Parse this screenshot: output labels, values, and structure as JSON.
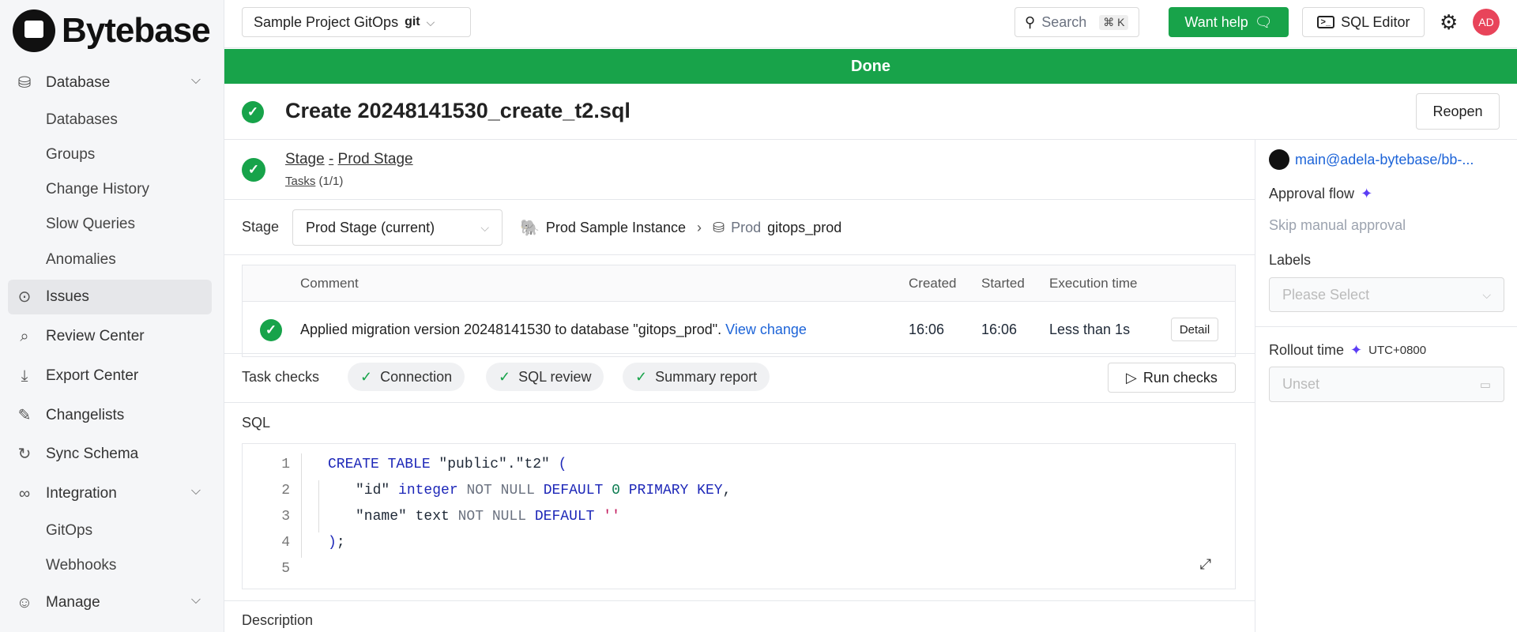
{
  "brand": {
    "name": "Bytebase"
  },
  "sidebar": {
    "items": [
      {
        "label": "Database",
        "icon": "database-icon",
        "expandable": true
      },
      {
        "label": "Databases",
        "sub": true
      },
      {
        "label": "Groups",
        "sub": true
      },
      {
        "label": "Change History",
        "sub": true
      },
      {
        "label": "Slow Queries",
        "sub": true
      },
      {
        "label": "Anomalies",
        "sub": true
      },
      {
        "label": "Issues",
        "icon": "circle-dot-icon",
        "active": true
      },
      {
        "label": "Review Center",
        "icon": "review-icon"
      },
      {
        "label": "Export Center",
        "icon": "download-icon"
      },
      {
        "label": "Changelists",
        "icon": "pencil-ruler-icon"
      },
      {
        "label": "Sync Schema",
        "icon": "refresh-icon"
      },
      {
        "label": "Integration",
        "icon": "link-icon",
        "expandable": true
      },
      {
        "label": "GitOps",
        "sub": true
      },
      {
        "label": "Webhooks",
        "sub": true
      },
      {
        "label": "Manage",
        "icon": "users-icon",
        "expandable": true
      }
    ]
  },
  "header": {
    "project": "Sample Project GitOps",
    "project_badge": "git",
    "search_placeholder": "Search",
    "search_shortcut": "⌘ K",
    "want_help": "Want help",
    "sql_editor": "SQL Editor",
    "avatar": "AD",
    "accent": "#18a34a"
  },
  "banner": {
    "status": "Done"
  },
  "issue": {
    "title": "Create 20248141530_create_t2.sql",
    "reopen": "Reopen"
  },
  "stage": {
    "link_stage": "Stage",
    "sep": "-",
    "link_name": "Prod Stage",
    "tasks_link": "Tasks",
    "tasks_count": "(1/1)",
    "label": "Stage",
    "select_value": "Prod Stage (current)",
    "instance": "Prod Sample Instance",
    "db_env": "Prod",
    "db_name": "gitops_prod"
  },
  "table": {
    "headers": [
      "Comment",
      "Created",
      "Started",
      "Execution time"
    ],
    "rows": [
      {
        "comment": "Applied migration version 20248141530 to database \"gitops_prod\".",
        "link": "View change",
        "created": "16:06",
        "started": "16:06",
        "exec": "Less than 1s",
        "action": "Detail"
      }
    ]
  },
  "checks": {
    "label": "Task checks",
    "items": [
      "Connection",
      "SQL review",
      "Summary report"
    ],
    "run": "Run checks"
  },
  "sql": {
    "label": "SQL",
    "line_numbers": [
      "1",
      "2",
      "3",
      "4",
      "5"
    ]
  },
  "description": {
    "label": "Description"
  },
  "right": {
    "git_link": "main@adela-bytebase/bb-...",
    "approval_label": "Approval flow",
    "approval_value": "Skip manual approval",
    "labels_label": "Labels",
    "labels_placeholder": "Please Select",
    "rollout_label": "Rollout time",
    "timezone": "UTC+0800",
    "rollout_placeholder": "Unset"
  }
}
